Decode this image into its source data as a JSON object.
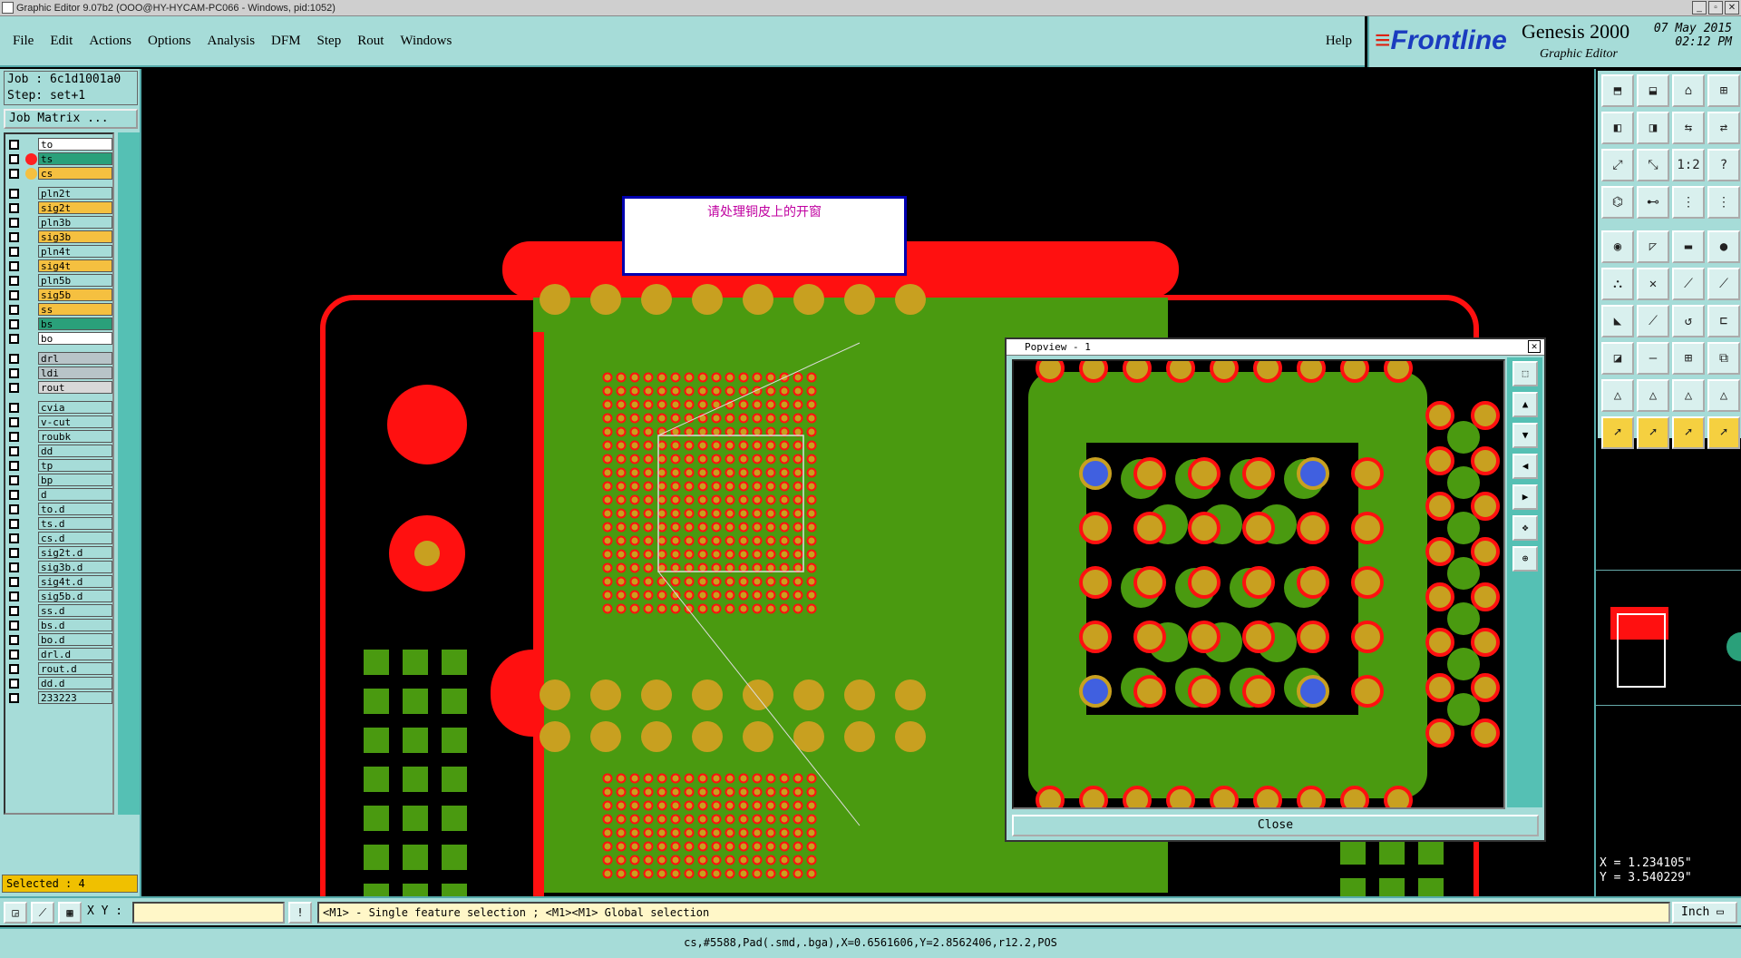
{
  "window": {
    "title": "Graphic Editor 9.07b2 (OOO@HY-HYCAM-PC066 - Windows, pid:1052)"
  },
  "menu": {
    "items": [
      "File",
      "Edit",
      "Actions",
      "Options",
      "Analysis",
      "DFM",
      "Step",
      "Rout",
      "Windows"
    ],
    "help": "Help"
  },
  "brand": {
    "logo": "Frontline",
    "product": "Genesis 2000",
    "subtitle": "Graphic Editor",
    "date": "07 May 2015",
    "time": "02:12 PM"
  },
  "job": {
    "job_label": "Job : 6c1d1001a0",
    "step_label": "Step: set+1",
    "matrix_button": "Job Matrix ..."
  },
  "layers": [
    {
      "name": "to",
      "color": "#ffffff",
      "dot": ""
    },
    {
      "name": "ts",
      "color": "#2aa07a",
      "dot": "#ff2020"
    },
    {
      "name": "cs",
      "color": "#f5c040",
      "dot": "#f5c040"
    },
    {
      "name": "pln2t",
      "color": "#a6dcd8",
      "dot": ""
    },
    {
      "name": "sig2t",
      "color": "#f5c040",
      "dot": ""
    },
    {
      "name": "pln3b",
      "color": "#a6dcd8",
      "dot": ""
    },
    {
      "name": "sig3b",
      "color": "#f5c040",
      "dot": ""
    },
    {
      "name": "pln4t",
      "color": "#a6dcd8",
      "dot": ""
    },
    {
      "name": "sig4t",
      "color": "#f5c040",
      "dot": ""
    },
    {
      "name": "pln5b",
      "color": "#a6dcd8",
      "dot": ""
    },
    {
      "name": "sig5b",
      "color": "#f5c040",
      "dot": ""
    },
    {
      "name": "ss",
      "color": "#f5c040",
      "dot": ""
    },
    {
      "name": "bs",
      "color": "#2aa07a",
      "dot": ""
    },
    {
      "name": "bo",
      "color": "#ffffff",
      "dot": ""
    },
    {
      "name": "drl",
      "color": "#b8c4c8",
      "dot": ""
    },
    {
      "name": "ldi",
      "color": "#b8c4c8",
      "dot": ""
    },
    {
      "name": "rout",
      "color": "#d8d8d8",
      "dot": ""
    },
    {
      "name": "cvia",
      "color": "#a6dcd8",
      "dot": ""
    },
    {
      "name": "v-cut",
      "color": "#a6dcd8",
      "dot": ""
    },
    {
      "name": "roubk",
      "color": "#a6dcd8",
      "dot": ""
    },
    {
      "name": "dd",
      "color": "#a6dcd8",
      "dot": ""
    },
    {
      "name": "tp",
      "color": "#a6dcd8",
      "dot": ""
    },
    {
      "name": "bp",
      "color": "#a6dcd8",
      "dot": ""
    },
    {
      "name": "d",
      "color": "#a6dcd8",
      "dot": ""
    },
    {
      "name": "to.d",
      "color": "#a6dcd8",
      "dot": ""
    },
    {
      "name": "ts.d",
      "color": "#a6dcd8",
      "dot": ""
    },
    {
      "name": "cs.d",
      "color": "#a6dcd8",
      "dot": ""
    },
    {
      "name": "sig2t.d",
      "color": "#a6dcd8",
      "dot": ""
    },
    {
      "name": "sig3b.d",
      "color": "#a6dcd8",
      "dot": ""
    },
    {
      "name": "sig4t.d",
      "color": "#a6dcd8",
      "dot": ""
    },
    {
      "name": "sig5b.d",
      "color": "#a6dcd8",
      "dot": ""
    },
    {
      "name": "ss.d",
      "color": "#a6dcd8",
      "dot": ""
    },
    {
      "name": "bs.d",
      "color": "#a6dcd8",
      "dot": ""
    },
    {
      "name": "bo.d",
      "color": "#a6dcd8",
      "dot": ""
    },
    {
      "name": "drl.d",
      "color": "#a6dcd8",
      "dot": ""
    },
    {
      "name": "rout.d",
      "color": "#a6dcd8",
      "dot": ""
    },
    {
      "name": "dd.d",
      "color": "#a6dcd8",
      "dot": ""
    },
    {
      "name": "233223",
      "color": "#a6dcd8",
      "dot": ""
    }
  ],
  "selected": "Selected : 4",
  "note": {
    "text": "请处理铜皮上的开窗"
  },
  "popview": {
    "title": "Popview - 1",
    "close_label": "Close"
  },
  "coords": {
    "x": "X =  1.234105\"",
    "y": "Y =  3.540229\""
  },
  "status": {
    "xy_label": "X Y :",
    "xy_value": "",
    "prompt": "<M1> - Single feature selection ; <M1><M1> Global selection",
    "unit": "Inch"
  },
  "info": {
    "text": "cs,#5588,Pad(.smd,.bga),X=0.6561606,Y=2.8562406,r12.2,POS"
  },
  "colors": {
    "panel": "#a6dcd8",
    "copper": "#4a9a10",
    "pad": "#c8a020",
    "mask": "#ff1010",
    "via": "#4060e0"
  }
}
